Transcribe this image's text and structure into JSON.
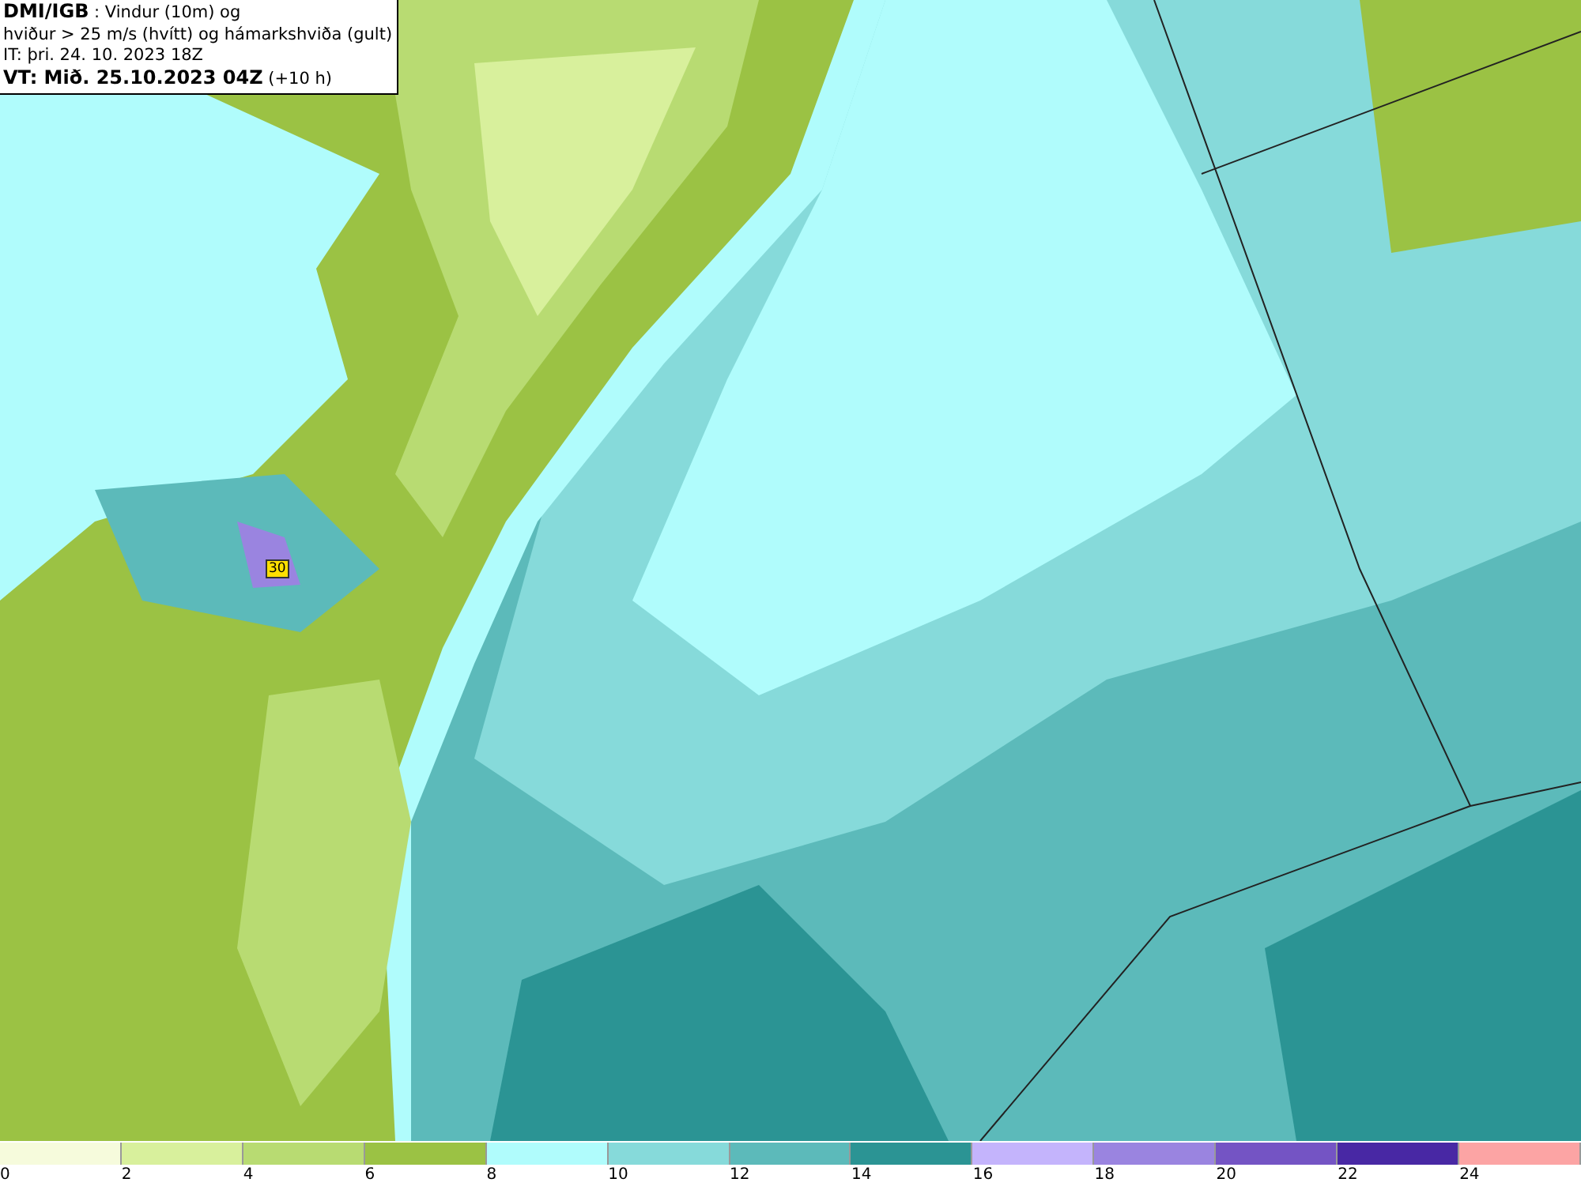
{
  "header": {
    "lines": [
      "**DMI/IGB** : Vindur (10m) og",
      "hviður > 25 m/s (hvítt) og hámarkshviða (gult)",
      "IT: þri. 24. 10. 2023 18Z",
      "**VT: Mið. 25.10.2023 04Z** (+10 h)"
    ]
  },
  "map": {
    "max_gust_label": "30"
  },
  "legend": {
    "bins": [
      {
        "color": "#f6fbdc",
        "label": "0"
      },
      {
        "color": "#d8f09c",
        "label": "2"
      },
      {
        "color": "#b8db72",
        "label": "4"
      },
      {
        "color": "#9bc244",
        "label": "6"
      },
      {
        "color": "#b0fcfc",
        "label": "8"
      },
      {
        "color": "#86dada",
        "label": "10"
      },
      {
        "color": "#5cbaba",
        "label": "12"
      },
      {
        "color": "#2b9494",
        "label": "14"
      },
      {
        "color": "#c4b4fc",
        "label": "16"
      },
      {
        "color": "#9a84e0",
        "label": "18"
      },
      {
        "color": "#7454c4",
        "label": "20"
      },
      {
        "color": "#4828a4",
        "label": "22"
      },
      {
        "color": "#fca4a4",
        "label": "24"
      }
    ]
  }
}
